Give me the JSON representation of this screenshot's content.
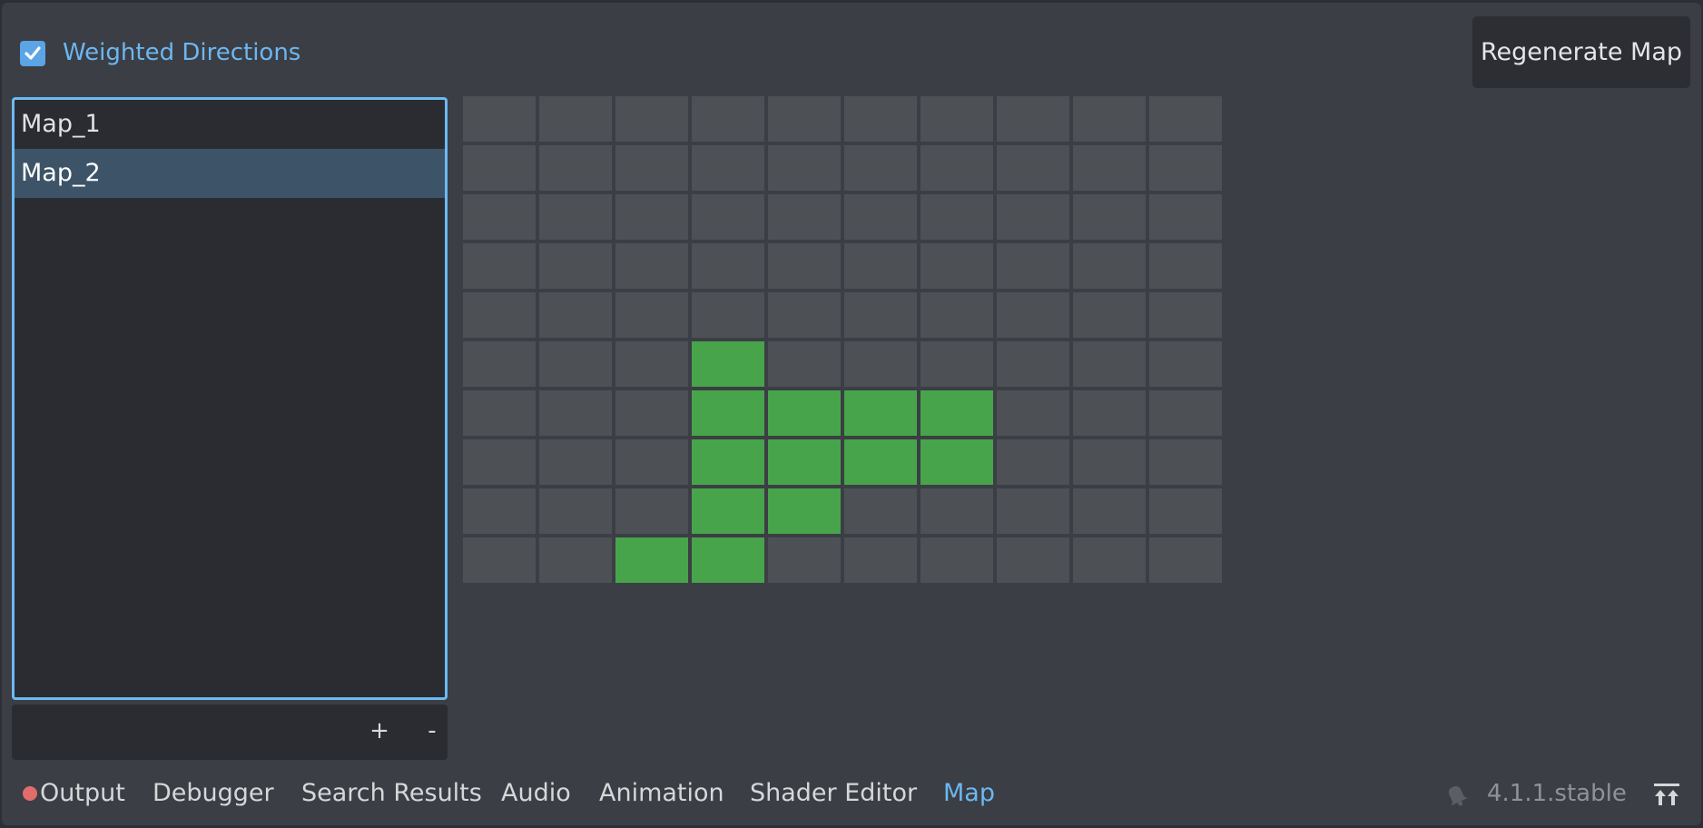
{
  "options": {
    "weighted_directions_label": "Weighted Directions",
    "weighted_directions_checked": true
  },
  "toolbar": {
    "regenerate_label": "Regenerate Map"
  },
  "map_list": {
    "items": [
      {
        "label": "Map_1",
        "selected": false
      },
      {
        "label": "Map_2",
        "selected": true
      }
    ],
    "add_label": "+",
    "remove_label": "-"
  },
  "map_grid": {
    "columns": 10,
    "rows": 10,
    "filled_color": "#47a44a",
    "empty_color": "#4d5055",
    "cells": [
      [
        0,
        0,
        0,
        0,
        0,
        0,
        0,
        0,
        0,
        0
      ],
      [
        0,
        0,
        0,
        0,
        0,
        0,
        0,
        0,
        0,
        0
      ],
      [
        0,
        0,
        0,
        0,
        0,
        0,
        0,
        0,
        0,
        0
      ],
      [
        0,
        0,
        0,
        0,
        0,
        0,
        0,
        0,
        0,
        0
      ],
      [
        0,
        0,
        0,
        0,
        0,
        0,
        0,
        0,
        0,
        0
      ],
      [
        0,
        0,
        0,
        1,
        0,
        0,
        0,
        0,
        0,
        0
      ],
      [
        0,
        0,
        0,
        1,
        1,
        1,
        1,
        0,
        0,
        0
      ],
      [
        0,
        0,
        0,
        1,
        1,
        1,
        1,
        0,
        0,
        0
      ],
      [
        0,
        0,
        0,
        1,
        1,
        0,
        0,
        0,
        0,
        0
      ],
      [
        0,
        0,
        1,
        1,
        0,
        0,
        0,
        0,
        0,
        0
      ]
    ]
  },
  "bottom_tabs": {
    "tabs": [
      {
        "label": "Output",
        "active": false
      },
      {
        "label": "Debugger",
        "active": false
      },
      {
        "label": "Search Results",
        "active": false
      },
      {
        "label": "Audio",
        "active": false
      },
      {
        "label": "Animation",
        "active": false
      },
      {
        "label": "Shader Editor",
        "active": false
      },
      {
        "label": "Map",
        "active": true
      }
    ],
    "output_indicator_color": "#e06c6c"
  },
  "status": {
    "version": "4.1.1.stable"
  },
  "colors": {
    "accent": "#6cb7f2",
    "selection": "#3d5468"
  },
  "icons": {
    "checkbox": "check-icon",
    "notifications": "bell-icon",
    "expand_panel": "expand-up-icon"
  }
}
